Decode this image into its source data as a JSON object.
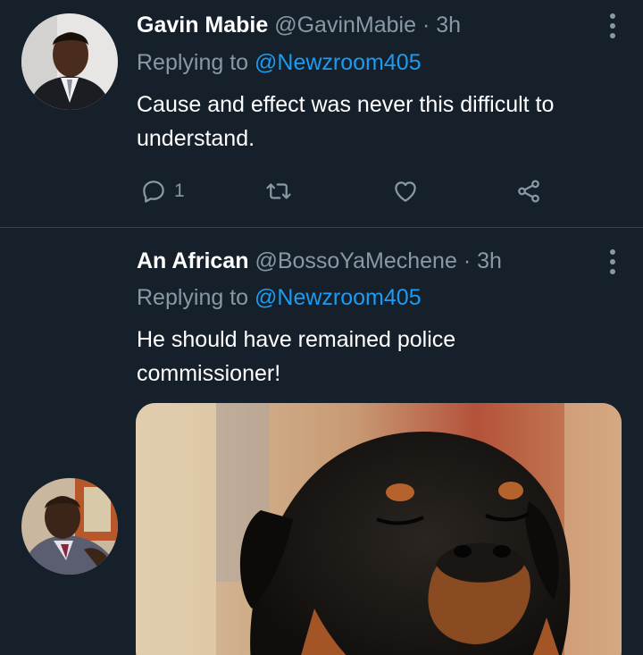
{
  "tweets": [
    {
      "name": "Gavin Mabie",
      "handle": "@GavinMabie",
      "separator": "·",
      "time": "3h",
      "replying_prefix": "Replying to",
      "replying_to": "@Newzroom405",
      "text": "Cause and effect was never this difficult to understand.",
      "reply_count": "1"
    },
    {
      "name": "An African",
      "handle": "@BossoYaMechene",
      "separator": "·",
      "time": "3h",
      "replying_prefix": "Replying to",
      "replying_to": "@Newzroom405",
      "text": "He should have remained police commissioner!"
    }
  ],
  "colors": {
    "background": "#15202b",
    "secondary_text": "#8899a6",
    "link": "#1d9bf0",
    "divider": "#38444d"
  },
  "icons": [
    "more-options-icon",
    "reply-icon",
    "retweet-icon",
    "like-icon",
    "share-icon"
  ]
}
